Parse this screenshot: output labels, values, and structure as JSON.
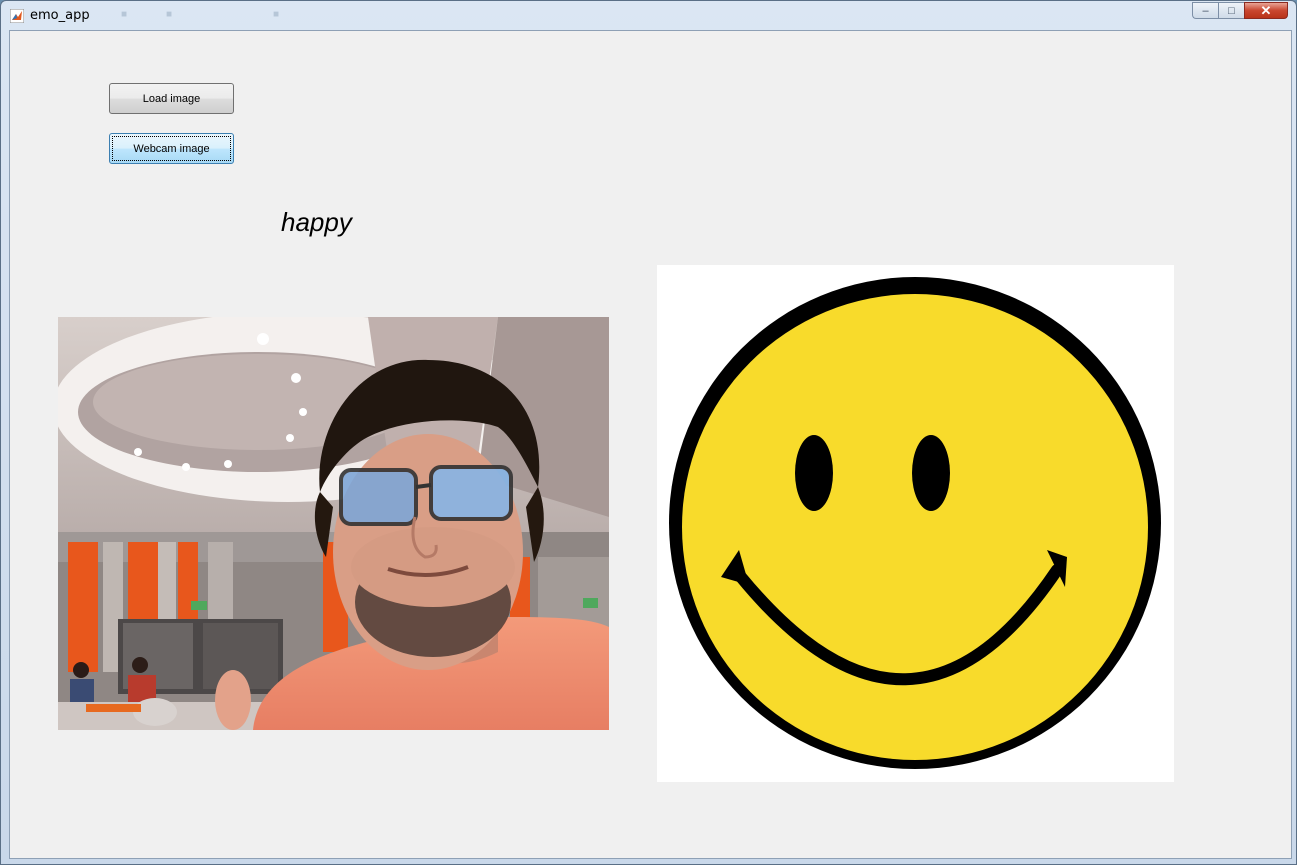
{
  "window": {
    "title": "emo_app",
    "controls": {
      "minimize": "–",
      "maximize": "□",
      "close": "✕"
    }
  },
  "toolbar": {
    "load_label": "Load image",
    "webcam_label": "Webcam image"
  },
  "result": {
    "emotion": "happy"
  },
  "colors": {
    "smiley_face": "#f8db2b",
    "smiley_outline": "#000000",
    "client_background": "#f0f0f0",
    "focused_button": "#bee6fd"
  },
  "icons": {
    "app": "matlab-icon",
    "emotion": "smiley-face-icon"
  }
}
